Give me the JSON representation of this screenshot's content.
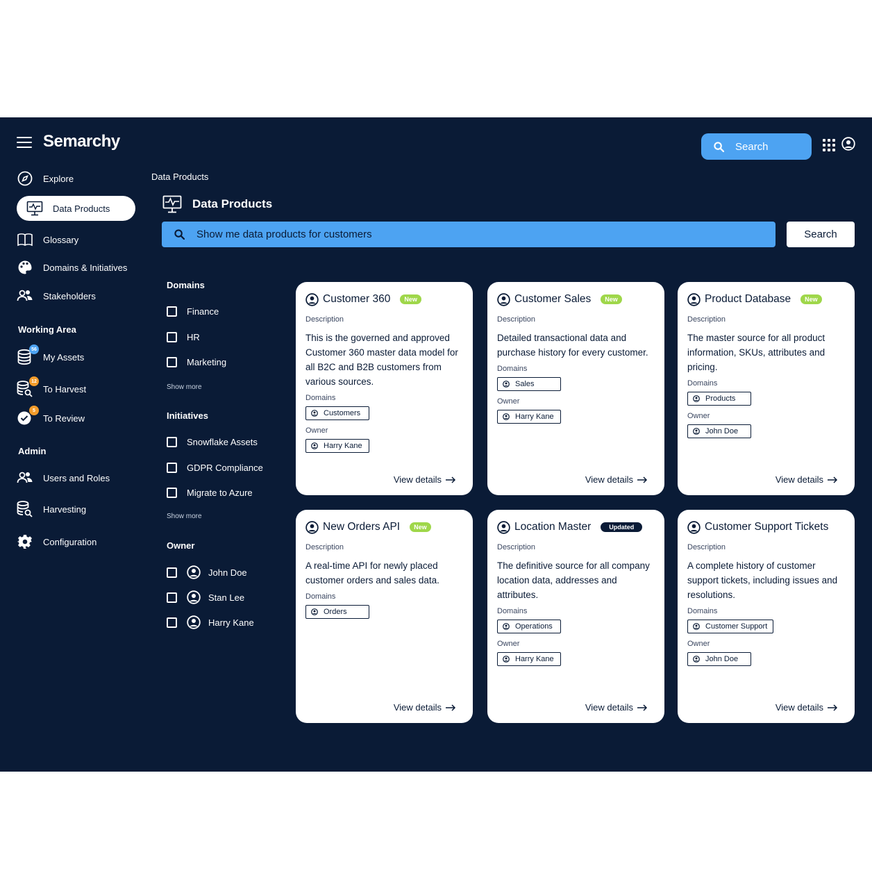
{
  "app": {
    "name": "Semarchy"
  },
  "topbar": {
    "search_label": "Search",
    "icons": [
      "menu-icon",
      "apps-grid-icon",
      "user-icon"
    ]
  },
  "sidebar": {
    "items": [
      {
        "label": "Explore",
        "icon": "compass-icon"
      },
      {
        "label": "Data Products",
        "icon": "monitor-pulse-icon",
        "active": true
      },
      {
        "label": "Glossary",
        "icon": "book-icon"
      },
      {
        "label": "Domains & Initiatives",
        "icon": "palette-icon"
      },
      {
        "label": "Stakeholders",
        "icon": "users-icon"
      }
    ],
    "working_area": {
      "title": "Working Area",
      "items": [
        {
          "label": "My Assets",
          "icon": "database-icon",
          "badge": "56",
          "badge_color": "#4da3f2"
        },
        {
          "label": "To Harvest",
          "icon": "database-search-icon",
          "badge": "12",
          "badge_color": "#f39c2b"
        },
        {
          "label": "To Review",
          "icon": "check-circle-icon",
          "badge": "5",
          "badge_color": "#f39c2b"
        }
      ]
    },
    "admin": {
      "title": "Admin",
      "items": [
        {
          "label": "Users and Roles",
          "icon": "users-icon"
        },
        {
          "label": "Harvesting",
          "icon": "database-search-icon"
        },
        {
          "label": "Configuration",
          "icon": "gear-icon"
        }
      ]
    }
  },
  "main": {
    "breadcrumb": "Data Products",
    "title": "Data Products",
    "search_value": "Show me data products for customers",
    "search_button": "Search"
  },
  "filters": {
    "domains": {
      "title": "Domains",
      "options": [
        "Finance",
        "HR",
        "Marketing"
      ],
      "show_more": "Show more"
    },
    "initiatives": {
      "title": "Initiatives",
      "options": [
        "Snowflake Assets",
        "GDPR Compliance",
        "Migrate to Azure"
      ],
      "show_more": "Show more"
    },
    "owner": {
      "title": "Owner",
      "options": [
        "John Doe",
        "Stan Lee",
        "Harry Kane"
      ]
    }
  },
  "labels": {
    "description": "Description",
    "domains": "Domains",
    "owner": "Owner",
    "view_details": "View details"
  },
  "cards": [
    {
      "title": "Customer 360",
      "tag": "New",
      "description": "This is the governed and approved Customer 360 master data model for all B2C and B2B customers from various sources.",
      "domain": "Customers",
      "owner": "Harry Kane"
    },
    {
      "title": "Customer Sales",
      "tag": "New",
      "description": "Detailed transactional data and purchase history for every customer.",
      "domain": "Sales",
      "owner": "Harry Kane"
    },
    {
      "title": "Product Database",
      "tag": "New",
      "description": "The master source for all product information, SKUs, attributes and pricing.",
      "domain": "Products",
      "owner": "John Doe"
    },
    {
      "title": "New Orders API",
      "tag": "New",
      "description": "A real-time API for newly placed customer orders and sales data.",
      "domain": "Orders",
      "owner": ""
    },
    {
      "title": "Location Master",
      "tag": "Updated",
      "description": "The definitive source for all company location data, addresses and attributes.",
      "domain": "Operations",
      "owner": "Harry Kane"
    },
    {
      "title": "Customer Support Tickets",
      "tag": "",
      "description": "A complete history of customer support tickets, including issues and resolutions.",
      "domain": "Customer Support",
      "owner": "John Doe"
    }
  ]
}
